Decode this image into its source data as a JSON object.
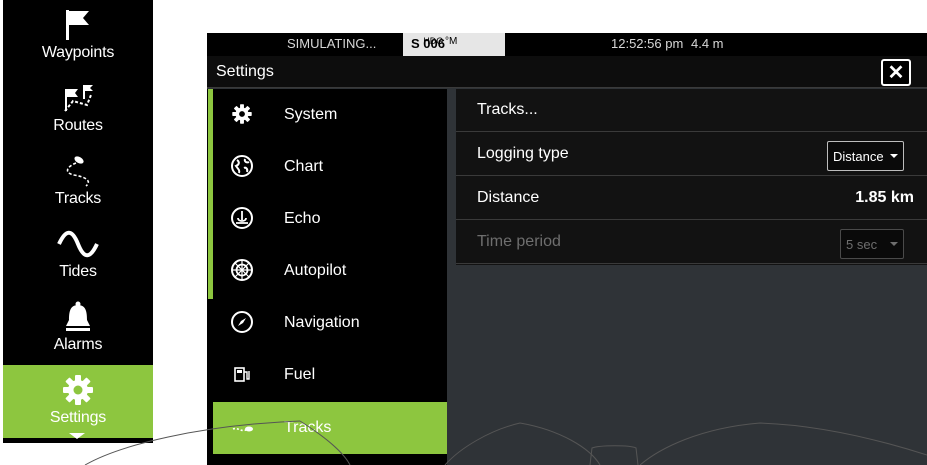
{
  "sidebar": {
    "items": [
      {
        "label": "Waypoints",
        "icon": "flag-icon"
      },
      {
        "label": "Routes",
        "icon": "route-flags-icon"
      },
      {
        "label": "Tracks",
        "icon": "track-icon"
      },
      {
        "label": "Tides",
        "icon": "wave-icon"
      },
      {
        "label": "Alarms",
        "icon": "bell-icon"
      },
      {
        "label": "Settings",
        "icon": "gear-icon",
        "active": true
      }
    ]
  },
  "status": {
    "simulating": "SIMULATING...",
    "hdg_prefix": "S",
    "hdg_label": "HDG",
    "hdg_value": "006",
    "hdg_unit": "°M",
    "time": "12:52:56 pm",
    "depth": "4.4 m"
  },
  "settings": {
    "title": "Settings",
    "close_label": "✕",
    "categories": [
      {
        "label": "System",
        "icon": "gear-icon"
      },
      {
        "label": "Chart",
        "icon": "globe-icon"
      },
      {
        "label": "Echo",
        "icon": "echo-icon"
      },
      {
        "label": "Autopilot",
        "icon": "helm-icon"
      },
      {
        "label": "Navigation",
        "icon": "compass-icon"
      },
      {
        "label": "Fuel",
        "icon": "fuel-pump-icon"
      },
      {
        "label": "Tracks",
        "icon": "track-icon",
        "active": true
      }
    ],
    "detail": {
      "tracks_link": "Tracks...",
      "logging_type_label": "Logging type",
      "logging_type_value": "Distance",
      "distance_label": "Distance",
      "distance_value": "1.85 km",
      "time_period_label": "Time period",
      "time_period_value": "5 sec"
    }
  },
  "colors": {
    "accent": "#8dc63f",
    "panel": "#121212",
    "background": "#2f3337"
  }
}
